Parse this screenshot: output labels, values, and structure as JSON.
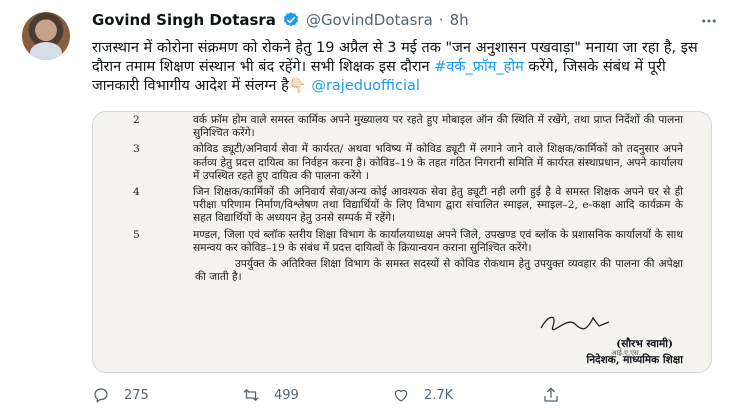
{
  "author": {
    "name": "Govind Singh Dotasra",
    "handle": "@GovindDotasra",
    "separator": "·",
    "time": "8h"
  },
  "tweet": {
    "text_part1": "राजस्थान में कोरोना संक्रमण को रोकने हेतु 19 अप्रैल से 3 मई तक \"जन अनुशासन पखवाड़ा\" मनाया जा रहा है, इस दौरान तमाम शिक्षण संस्थान भी बंद रहेंगे। सभी शिक्षक इस दौरान ",
    "hashtag": "#वर्क_फ्रॉम_होम",
    "text_part2": " करेंगे, जिसके संबंध में पूरी जानकारी विभागीय आदेश में संलग्न है👇🏻 ",
    "mention": "@rajeduofficial"
  },
  "document": {
    "items": [
      {
        "num": "2",
        "text": "वर्क फ्रॉम होम वाले समस्त कार्मिक अपने मुख्यालय पर रहते हुए मोबाइल ऑन की स्थिति में रखेंगे, तथा प्राप्त निर्देशों की पालना सुनिश्चित करेंगे।"
      },
      {
        "num": "3",
        "text": "कोविड ड्यूटी/अनिवार्य सेवा में कार्यरत/ अथवा भविष्य में कोविड ड्यूटी में लगाने जाने वाले शिक्षक/कार्मिकों को तदनुसार अपने कर्तव्य हेतु प्रदत्त दायित्व का निर्वहन करना है। कोविड–19 के तहत गठित निगरानी समिति में कार्यरत संस्थाप्रधान, अपने कार्यालय में उपस्थित रहते हुए दायित्व की पालना करेंगे ।"
      },
      {
        "num": "4",
        "text": "जिन शिक्षक/कार्मिकों की अनिवार्य सेवा/अन्य कोई आवश्यक सेवा हेतु ड्यूटी नही लगी हुई है वे समस्त शिक्षक अपने घर से ही परीक्षा परिणाम निर्माण/विश्लेषण तथा विद्यार्थियों के लिए विभाग द्वारा संचालित स्माइल, स्माइल–2, e-कक्षा आदि कार्यक्रम के सहत विद्यार्थियों के अध्ययन हेतु उनसे सम्पर्क में रहेंगे।"
      },
      {
        "num": "5",
        "text": "मण्डल, जिला एवं ब्लॉक स्तरीय शिक्षा विभाग के कार्यालयाध्यक्ष अपने जिले, उपखण्ड एवं ब्लॉक के प्रशासनिक कार्यालयों के साथ समन्वय कर कोविड–19 के संबंध में प्रदत्त दायित्वों के क्रियान्वयन कराना सुनिश्चित करेंगे।"
      }
    ],
    "closing": "उपर्युक्त के अतिरिक्त शिक्षा विभाग के समस्त सदस्यों से कोविड रोकथाम हेतु उपयुक्त व्यवहार की पालना की अपेक्षा की जाती है।",
    "signatory_name": "(सौरभ स्वामी)",
    "signatory_title": "निदेशक, माध्यमिक शिक्षा",
    "stamp_text": "आई.ए.एस."
  },
  "actions": {
    "replies": "275",
    "retweets": "499",
    "likes": "2.7K"
  },
  "colors": {
    "accent": "#1d9bf0",
    "muted": "#536471",
    "text": "#0f1419"
  },
  "icons": [
    "verified-badge-icon",
    "more-icon",
    "reply-icon",
    "retweet-icon",
    "like-icon",
    "share-icon"
  ]
}
